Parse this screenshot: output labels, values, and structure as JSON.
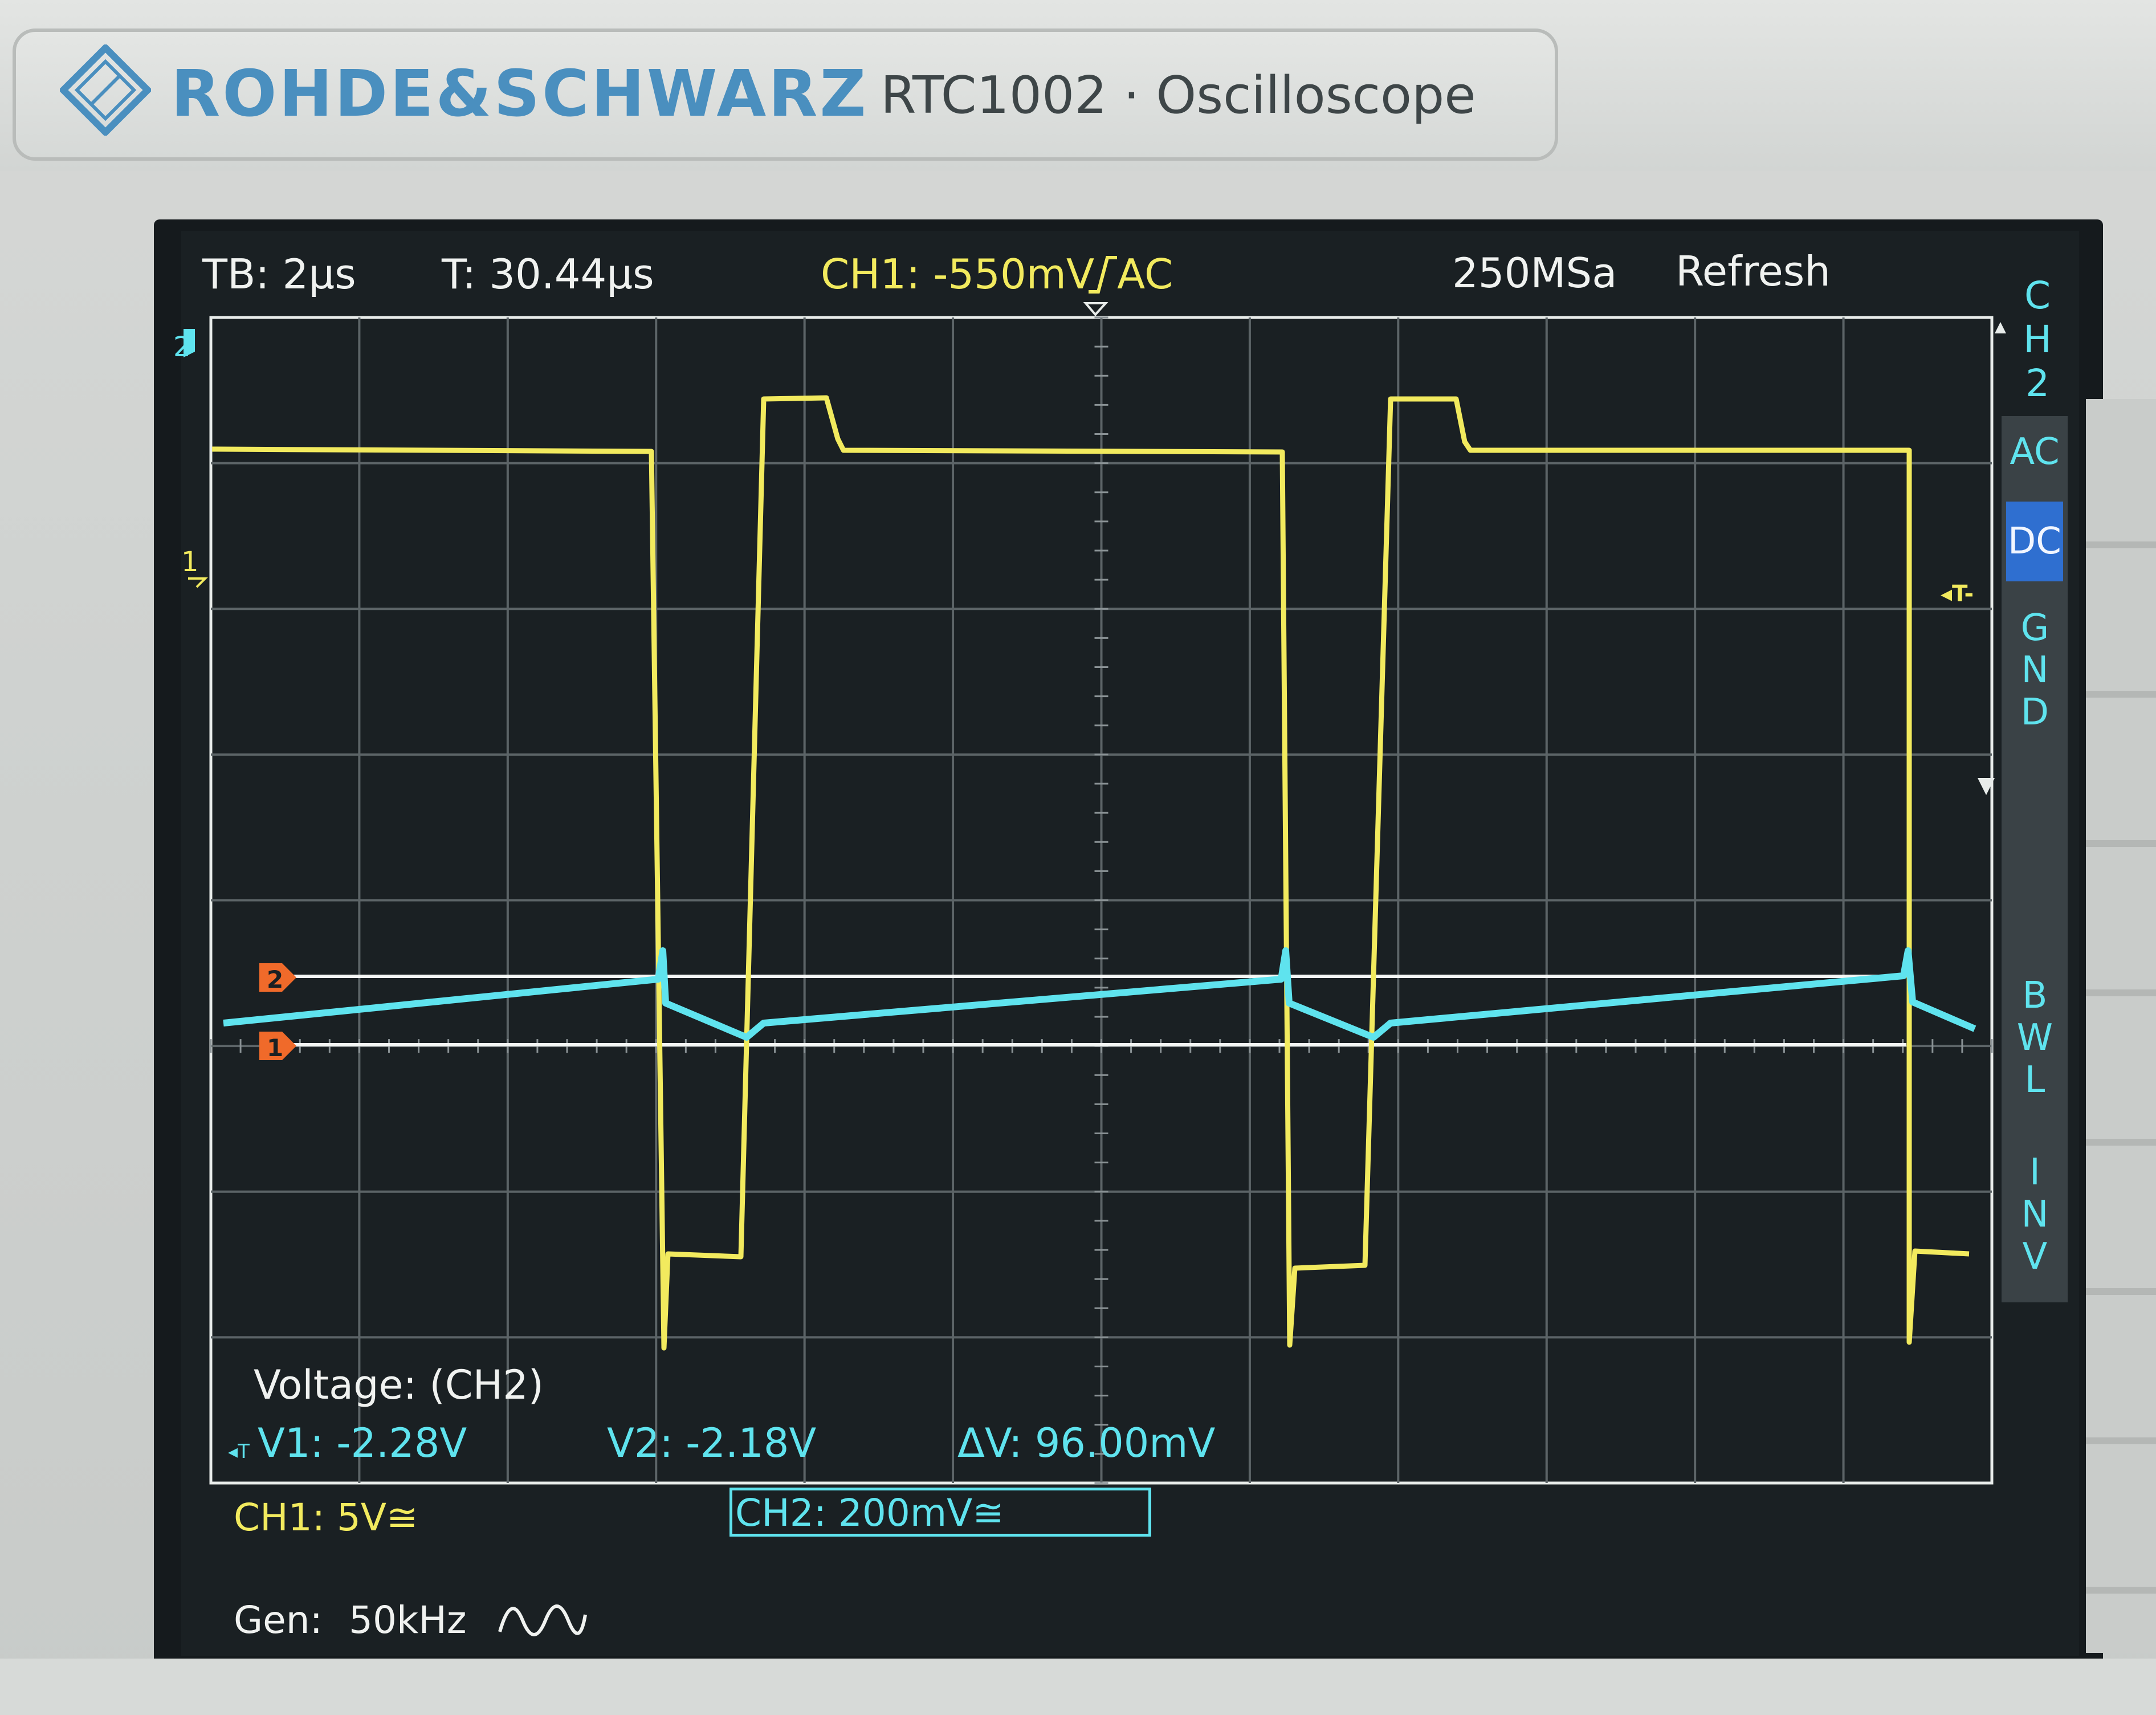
{
  "header": {
    "brand": "ROHDE&SCHWARZ",
    "model": "RTC1002 · Oscilloscope"
  },
  "status_bar": {
    "timebase": "TB: 2µs",
    "trigger_time": "T: 30.44µs",
    "trigger_info": "CH1: -550mV",
    "trigger_coupling": "AC",
    "sample_rate": "250MSa",
    "mode": "Refresh"
  },
  "channel_menu": {
    "title": "CH2",
    "coupling_ac": "AC",
    "coupling_dc": "DC",
    "coupling_gnd": "GND",
    "bwl": "BWL",
    "inv": "INV",
    "selected": "DC"
  },
  "markers": {
    "ch2_ground": "2",
    "ch1_ground": "1",
    "cursor_2": "2",
    "cursor_1": "1",
    "trigger_marker": "T"
  },
  "measurement": {
    "title": "Voltage: (CH2)",
    "v1": "V1: -2.28V",
    "v2": "V2: -2.18V",
    "delta_v": "ΔV: 96.00mV"
  },
  "scales": {
    "ch1": "CH1: 5V≅",
    "ch2": "CH2: 200mV≅"
  },
  "generator": {
    "label": "Gen:",
    "frequency": "50kHz"
  },
  "colors": {
    "ch1": "#f2ea5e",
    "ch2": "#5fe3ee",
    "grid": "#6a7275",
    "screen_bg": "#1a2023",
    "accent": "#4a8fbf",
    "selected": "#2f6fd0"
  }
}
